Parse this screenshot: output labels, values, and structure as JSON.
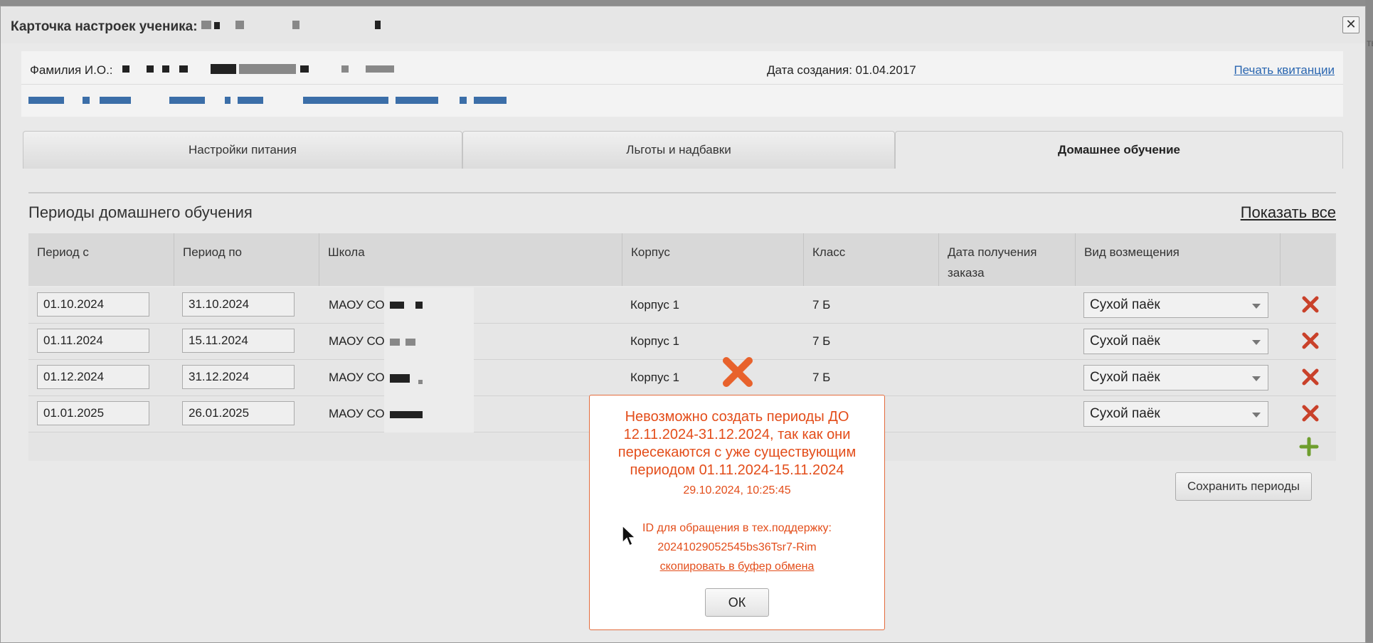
{
  "window": {
    "title": "Карточка настроек ученика:",
    "close_label": "✕"
  },
  "info": {
    "fio_label": "Фамилия И.О.:",
    "created_label": "Дата создания: 01.04.2017",
    "print_link": "Печать квитанции"
  },
  "tabs": [
    {
      "label": "Настройки питания"
    },
    {
      "label": "Льготы и надбавки"
    },
    {
      "label": "Домашнее обучение"
    }
  ],
  "section": {
    "title": "Периоды домашнего обучения",
    "show_all": "Показать все"
  },
  "table": {
    "headers": [
      "Период с",
      "Период по",
      "Школа",
      "Корпус",
      "Класс",
      "Дата получения заказа",
      "Вид возмещения"
    ],
    "rows": [
      {
        "from": "01.10.2024",
        "to": "31.10.2024",
        "school": "МАОУ СО",
        "building": "Корпус 1",
        "class": "7 Б",
        "type": "Сухой паёк"
      },
      {
        "from": "01.11.2024",
        "to": "15.11.2024",
        "school": "МАОУ СО",
        "building": "Корпус 1",
        "class": "7 Б",
        "type": "Сухой паёк"
      },
      {
        "from": "01.12.2024",
        "to": "31.12.2024",
        "school": "МАОУ СО",
        "building": "Корпус 1",
        "class": "7 Б",
        "type": "Сухой паёк"
      },
      {
        "from": "01.01.2025",
        "to": "26.01.2025",
        "school": "МАОУ СО",
        "building": "",
        "class": "",
        "type": "Сухой паёк"
      }
    ]
  },
  "save_button": "Сохранить периоды",
  "dialog": {
    "message": "Невозможно создать периоды ДО 12.11.2024-31.12.2024, так как они пересекаются с уже существующим периодом 01.11.2024-15.11.2024",
    "timestamp": "29.10.2024, 10:25:45",
    "id_label": "ID для обращения в тех.поддержку:",
    "id_value": "20241029052545bs36Tsr7-Rim",
    "copy_link": "скопировать в буфер обмена",
    "ok": "ОК"
  },
  "colors": {
    "error": "#e34d1a",
    "delete": "#c9412a",
    "add": "#6e9e2e",
    "link": "#2a66b0"
  },
  "edge_fragment": "ть"
}
